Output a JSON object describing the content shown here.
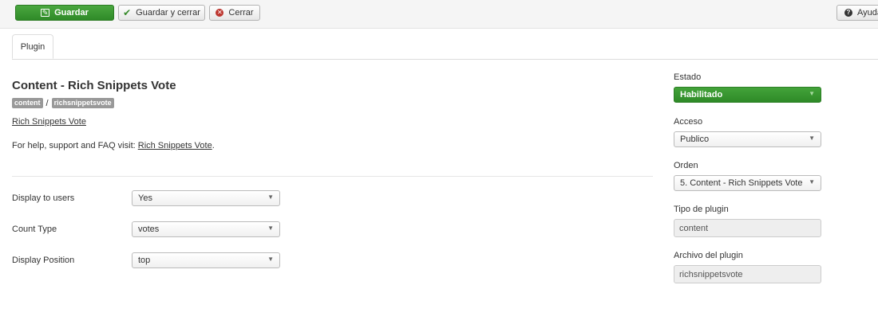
{
  "toolbar": {
    "save_label": "Guardar",
    "save_close_label": "Guardar y cerrar",
    "close_label": "Cerrar",
    "help_label": "Ayuda"
  },
  "tabs": [
    {
      "label": "Plugin"
    }
  ],
  "plugin": {
    "title": "Content - Rich Snippets Vote",
    "badges": [
      "content",
      "richsnippetsvote"
    ],
    "separator": "/",
    "link_text": "Rich Snippets Vote",
    "help_prefix": "For help, support and FAQ visit: ",
    "help_link": "Rich Snippets Vote",
    "help_suffix": "."
  },
  "fields": [
    {
      "label": "Display to users",
      "value": "Yes"
    },
    {
      "label": "Count Type",
      "value": "votes"
    },
    {
      "label": "Display Position",
      "value": "top"
    }
  ],
  "sidebar": {
    "status": {
      "label": "Estado",
      "value": "Habilitado"
    },
    "access": {
      "label": "Acceso",
      "value": "Publico"
    },
    "order": {
      "label": "Orden",
      "value": "5. Content - Rich Snippets Vote"
    },
    "plugin_type": {
      "label": "Tipo de plugin",
      "value": "content"
    },
    "plugin_file": {
      "label": "Archivo del plugin",
      "value": "richsnippetsvote"
    }
  },
  "icons": {
    "save": "edit-icon",
    "save_close": "check-icon",
    "close": "close-circle-icon",
    "help": "question-circle-icon",
    "dropdown": "caret-down-icon"
  },
  "colors": {
    "save_button": "#3a9a31",
    "status_enabled": "#3a9a31",
    "close_icon": "#bd362f",
    "badge": "#999999"
  }
}
